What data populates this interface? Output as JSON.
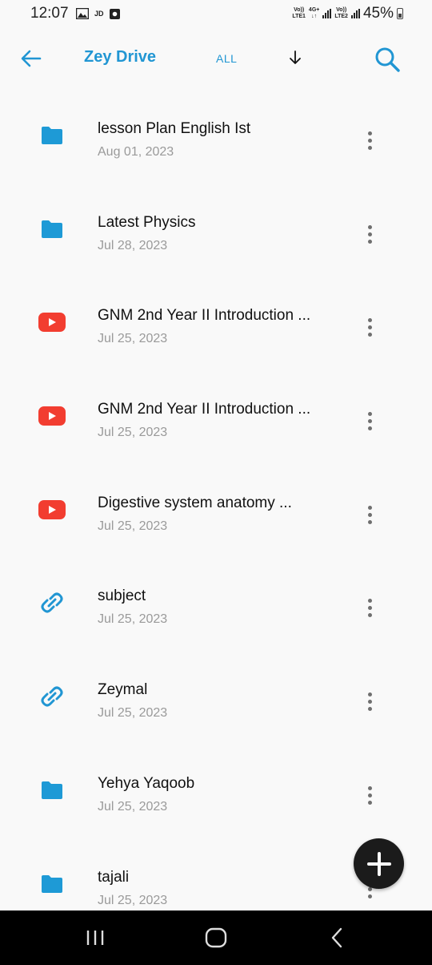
{
  "status_bar": {
    "time": "12:07",
    "jd_label": "JD",
    "sim1_top": "Vo))",
    "sim1_bottom": "LTE1",
    "net_top": "4G+",
    "net_bottom": "↓↑",
    "sim2_top": "Vo))",
    "sim2_bottom": "LTE2",
    "battery": "45%"
  },
  "toolbar": {
    "title": "Zey Drive",
    "filter": "ALL"
  },
  "colors": {
    "accent": "#2196d3",
    "folder": "#1e9ad6",
    "youtube": "#f23d30",
    "link": "#2196d3",
    "fab": "#1b1b1b"
  },
  "items": [
    {
      "name": "lesson Plan English Ist",
      "date": "Aug 01, 2023",
      "type": "folder-icon"
    },
    {
      "name": "Latest Physics",
      "date": "Jul 28, 2023",
      "type": "folder-icon"
    },
    {
      "name": "GNM 2nd Year II Introduction ...",
      "date": "Jul 25, 2023",
      "type": "youtube-icon"
    },
    {
      "name": "GNM 2nd Year II Introduction ...",
      "date": "Jul 25, 2023",
      "type": "youtube-icon"
    },
    {
      "name": "Digestive system anatomy ...",
      "date": "Jul 25, 2023",
      "type": "youtube-icon"
    },
    {
      "name": "subject",
      "date": "Jul 25, 2023",
      "type": "link-icon"
    },
    {
      "name": "Zeymal",
      "date": "Jul 25, 2023",
      "type": "link-icon"
    },
    {
      "name": "Yehya Yaqoob",
      "date": "Jul 25, 2023",
      "type": "folder-icon"
    },
    {
      "name": "tajali",
      "date": "Jul 25, 2023",
      "type": "folder-icon"
    }
  ]
}
